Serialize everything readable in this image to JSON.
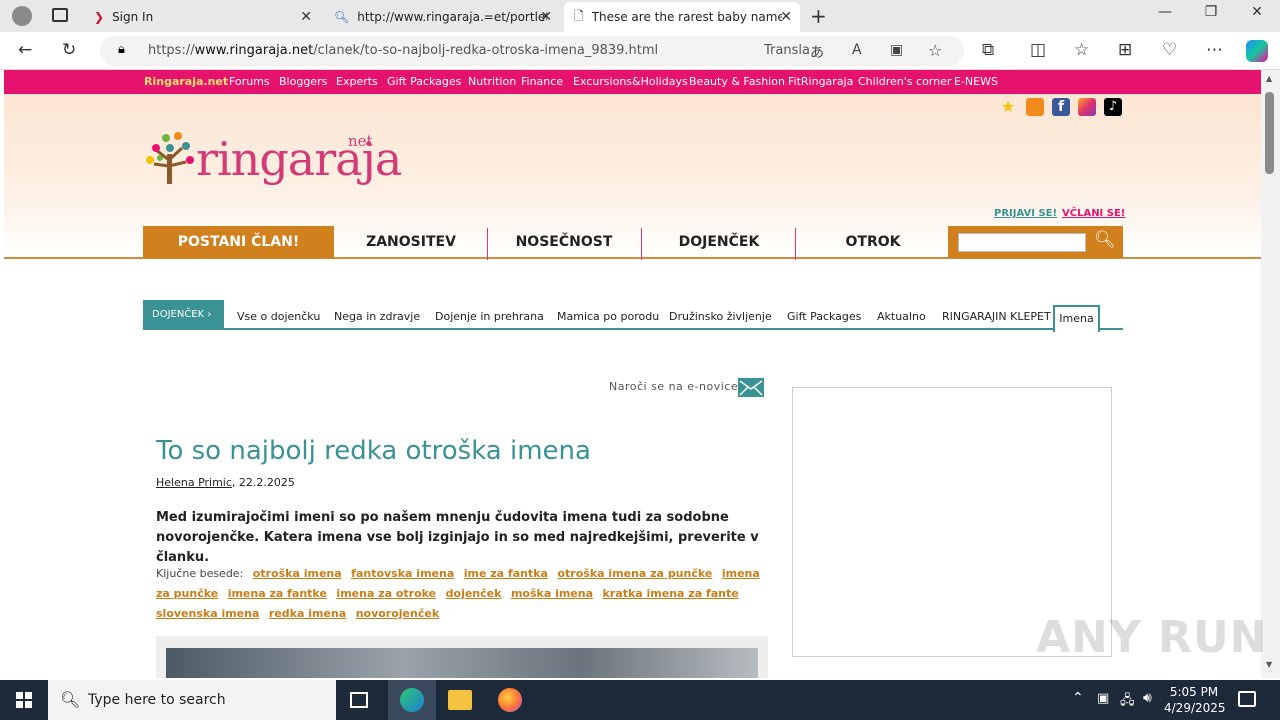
{
  "browser": {
    "tabs": [
      {
        "label": "Sign In"
      },
      {
        "label": "http://www.ringaraja.=et/portlet"
      },
      {
        "label": "These are the rarest baby names"
      }
    ],
    "url_prefix": "https://",
    "url_domain": "www.ringaraja.net",
    "url_path": "/clanek/to-so-najbolj-redka-otroska-imena_9839.html",
    "translate_label": "Transla"
  },
  "site": {
    "topnav": [
      "Ringaraja.net",
      "Forums",
      "Bloggers",
      "Experts",
      "Gift Packages",
      "Nutrition",
      "Finance",
      "Excursions&Holidays",
      "Beauty & Fashion",
      "FitRingaraja",
      "Children's corner",
      "E-NEWS"
    ],
    "logo_text": "ringaraja",
    "logo_net": "net",
    "login": "PRIJAVI SE!",
    "register": "VČLANI SE!",
    "become_member": "POSTANI ČLAN!",
    "menu": [
      "ZANOSITEV",
      "NOSEČNOST",
      "DOJENČEK",
      "OTROK"
    ],
    "subnav_head": "DOJENČEK",
    "subnav": [
      "Vse o dojenčku",
      "Nega in zdravje",
      "Dojenje in prehrana",
      "Mamica po porodu",
      "Družinsko življenje",
      "Gift Packages",
      "Aktualno",
      "RINGARAJIN KLEPET"
    ],
    "subnav_active": "Imena",
    "newsletter": "Naroči se na e-novice!"
  },
  "article": {
    "title": "To so najbolj redka otroška imena",
    "author": "Helena Primic",
    "date": ", 22.2.2025",
    "lead": "Med izumirajočimi imeni so po našem mnenju čudovita imena tudi za sodobne novorojenčke. Katera imena vse bolj izginjajo in so med najredkejšimi, preverite v članku.",
    "keywords_label": "Ključne besede:",
    "keywords": [
      "otroška imena",
      "fantovska imena",
      "ime za fantka",
      "otroška imena za punčke",
      "imena za punčke",
      "imena za fantke",
      "imena za otroke",
      "dojenček",
      "moška imena",
      "kratka imena za fante",
      "slovenska imena",
      "redka imena",
      "novorojenček"
    ]
  },
  "taskbar": {
    "search_placeholder": "Type here to search",
    "time": "5:05 PM",
    "date": "4/29/2025"
  },
  "watermark": "ANY RUN",
  "colors": {
    "pink": "#e5126e",
    "teal": "#3a9295",
    "orange": "#d1801e"
  }
}
